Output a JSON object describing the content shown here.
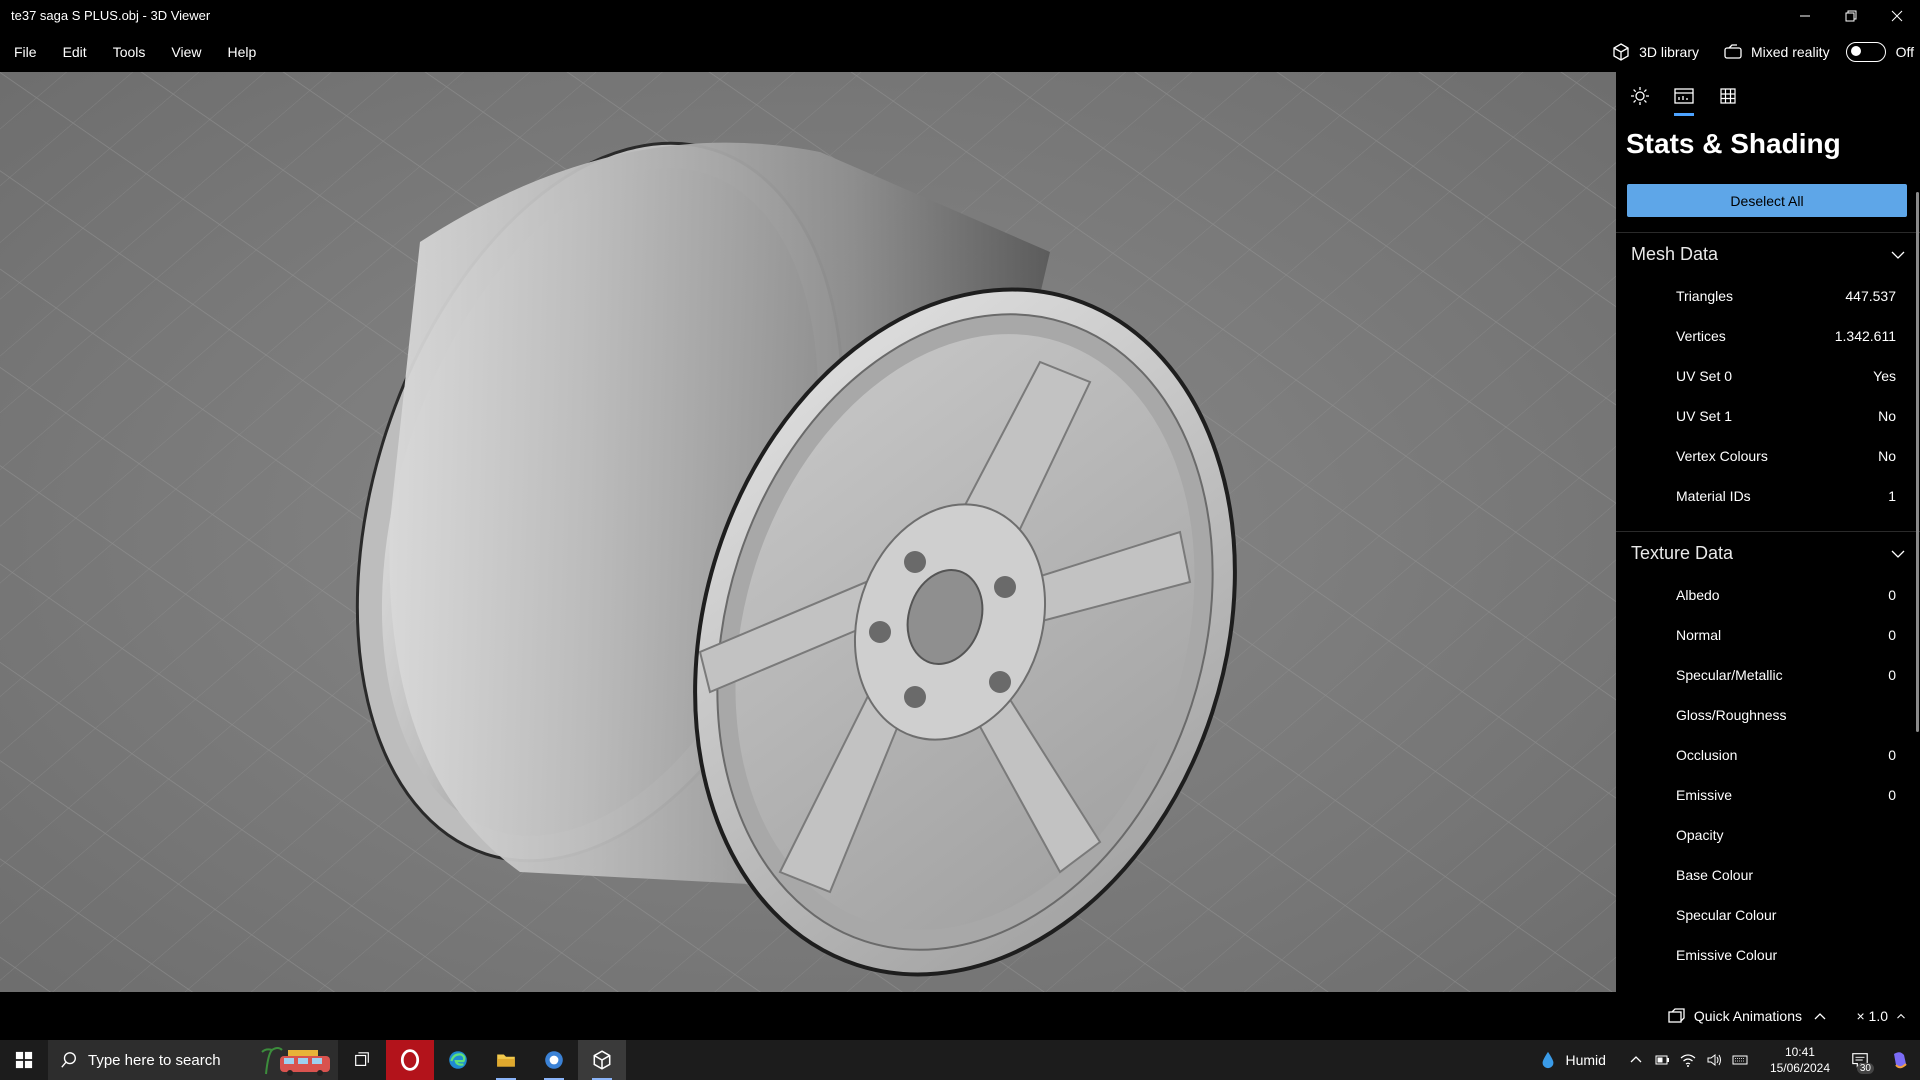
{
  "window": {
    "title": "te37 saga S PLUS.obj - 3D Viewer"
  },
  "menu": {
    "items": [
      "File",
      "Edit",
      "Tools",
      "View",
      "Help"
    ],
    "library_label": "3D library",
    "mixed_reality_label": "Mixed reality",
    "toggle_state": "Off"
  },
  "panel": {
    "tabs": [
      "lighting-icon",
      "stats-shading-icon",
      "grid-icon"
    ],
    "title": "Stats & Shading",
    "deselect_label": "Deselect All",
    "mesh_section": "Mesh Data",
    "mesh_rows": [
      {
        "label": "Triangles",
        "value": "447.537"
      },
      {
        "label": "Vertices",
        "value": "1.342.611"
      },
      {
        "label": "UV Set 0",
        "value": "Yes"
      },
      {
        "label": "UV Set 1",
        "value": "No"
      },
      {
        "label": "Vertex Colours",
        "value": "No"
      },
      {
        "label": "Material IDs",
        "value": "1"
      }
    ],
    "texture_section": "Texture Data",
    "texture_rows": [
      {
        "label": "Albedo",
        "value": "0"
      },
      {
        "label": "Normal",
        "value": "0"
      },
      {
        "label": "Specular/Metallic",
        "value": "0"
      },
      {
        "label": "Gloss/Roughness",
        "value": ""
      },
      {
        "label": "Occlusion",
        "value": "0"
      },
      {
        "label": "Emissive",
        "value": "0"
      },
      {
        "label": "Opacity",
        "value": ""
      },
      {
        "label": "Base Colour",
        "value": ""
      },
      {
        "label": "Specular Colour",
        "value": ""
      },
      {
        "label": "Emissive Colour",
        "value": ""
      }
    ]
  },
  "status": {
    "quick_animations": "Quick Animations",
    "zoom": "× 1.0"
  },
  "taskbar": {
    "search_placeholder": "Type here to search",
    "weather": "Humid",
    "time": "10:41",
    "date": "15/06/2024",
    "notification_count": "30"
  },
  "colors": {
    "accent": "#5ea6e8",
    "viewport_bg": "#7d7d7d"
  }
}
